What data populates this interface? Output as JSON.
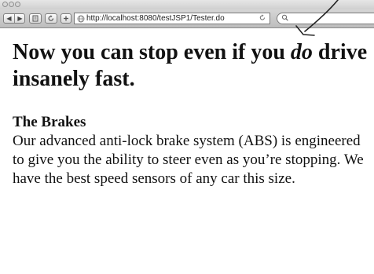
{
  "browser": {
    "url": "http://localhost:8080/testJSP1/Tester.do",
    "back_glyph": "◀",
    "forward_glyph": "▶",
    "icons": [
      "back-icon",
      "forward-icon",
      "page-icon",
      "reload-icon",
      "add-icon",
      "globe-icon",
      "search-icon"
    ]
  },
  "page": {
    "headline_part1": "Now you can stop even if you ",
    "headline_emphasis": "do",
    "headline_part2": " drive insanely fast.",
    "section_title": "The Brakes",
    "section_body": "Our advanced anti-lock brake system (ABS) is engineered to give you the ability to steer even as you’re stopping. We have the best speed sensors of any car this size."
  },
  "colors": {
    "chrome": "#c8c8c8",
    "text": "#111111",
    "background": "#ffffff"
  }
}
